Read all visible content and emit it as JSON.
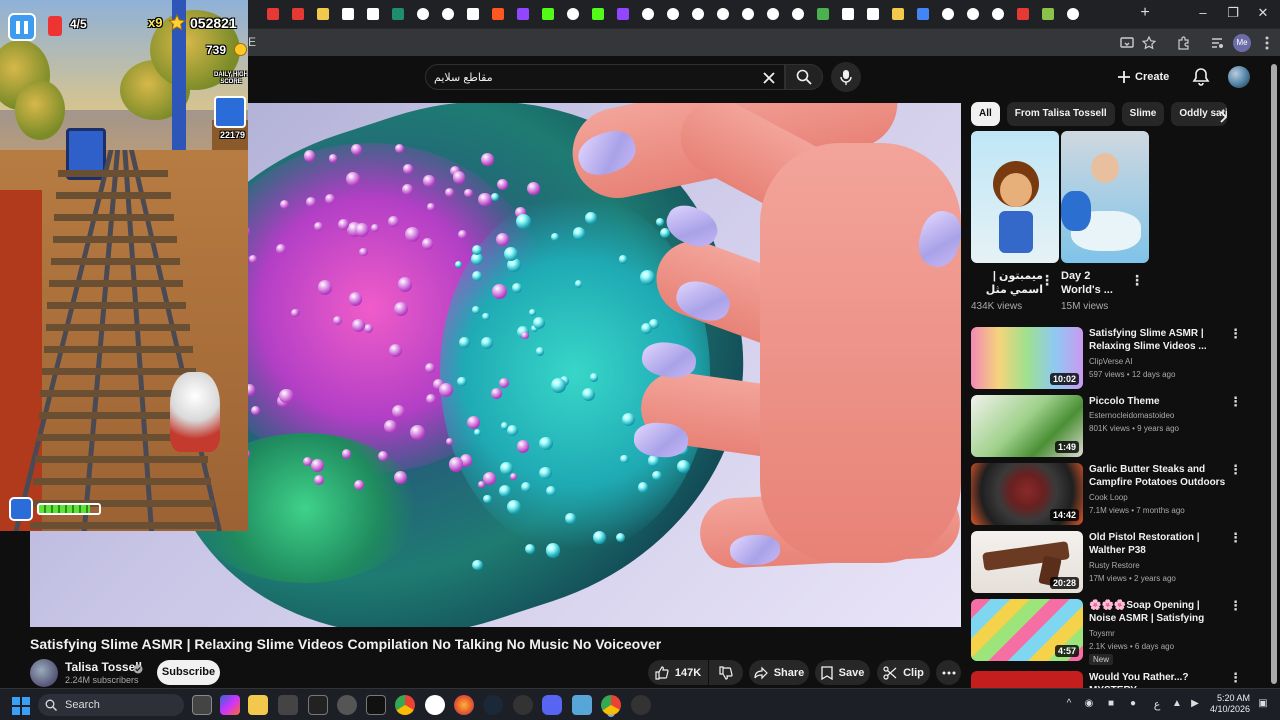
{
  "browser": {
    "new_tab_label": "+",
    "address_text": "E",
    "profile_initials": "Me",
    "tabs": [
      {
        "color": "#e53935",
        "icon": "youtube-icon"
      },
      {
        "color": "#e53935",
        "icon": "youtube-icon"
      },
      {
        "color": "#f2c94c",
        "icon": "generic-site-icon"
      },
      {
        "color": "#ffffff",
        "icon": "generic-site-icon"
      },
      {
        "color": "#ffffff",
        "icon": "wikipedia-icon"
      },
      {
        "color": "#1e8e6e",
        "icon": "generic-site-icon"
      },
      {
        "color": "#ffffff",
        "icon": "google-icon"
      },
      {
        "color": "#ffffff",
        "icon": "google-icon"
      },
      {
        "color": "#ffffff",
        "icon": "compass-icon"
      },
      {
        "color": "#ff5722",
        "icon": "generic-site-icon"
      },
      {
        "color": "#9146ff",
        "icon": "twitch-icon"
      },
      {
        "color": "#53fc18",
        "icon": "kick-icon"
      },
      {
        "color": "#ffffff",
        "icon": "google-icon"
      },
      {
        "color": "#53fc18",
        "icon": "kick-icon"
      },
      {
        "color": "#9146ff",
        "icon": "twitch-icon"
      },
      {
        "color": "#ffffff",
        "icon": "google-icon"
      },
      {
        "color": "#ffffff",
        "icon": "google-icon"
      },
      {
        "color": "#ffffff",
        "icon": "google-icon"
      },
      {
        "color": "#ffffff",
        "icon": "google-icon"
      },
      {
        "color": "#ffffff",
        "icon": "google-icon"
      },
      {
        "color": "#ffffff",
        "icon": "google-icon"
      },
      {
        "color": "#ffffff",
        "icon": "google-icon"
      },
      {
        "color": "#4caf50",
        "icon": "grid-icon"
      },
      {
        "color": "#ffffff",
        "icon": "pen-icon"
      },
      {
        "color": "#ffffff",
        "icon": "pen-icon"
      },
      {
        "color": "#f2c94c",
        "icon": "docs-icon"
      },
      {
        "color": "#4285f4",
        "icon": "generic-site-icon"
      },
      {
        "color": "#ffffff",
        "icon": "google-icon"
      },
      {
        "color": "#ffffff",
        "icon": "google-icon"
      },
      {
        "color": "#ffffff",
        "icon": "google-icon"
      },
      {
        "color": "#e53935",
        "icon": "pdf-icon"
      },
      {
        "color": "#8bc34a",
        "icon": "generic-site-icon"
      },
      {
        "color": "#ffffff",
        "icon": "google-icon"
      }
    ]
  },
  "youtube": {
    "search_query": "مقاطع سلايم",
    "create_label": "Create",
    "video": {
      "title": "Satisfying Slime ASMR | Relaxing Slime Videos Compilation No Talking No Music No Voiceover",
      "channel": "Talisa Tossell",
      "subscribers": "2.24M subscribers",
      "subscribe_label": "Subscribe",
      "likes": "147K",
      "share_label": "Share",
      "save_label": "Save",
      "clip_label": "Clip"
    },
    "chips": [
      "All",
      "From Talisa Tossell",
      "Slime",
      "Oddly satis"
    ],
    "shorts": [
      {
        "title": "ميمبتون | اسمي مثل طفول وضي...",
        "views": "434K views"
      },
      {
        "title": "Day 2 World's ...",
        "views": "15M views"
      }
    ],
    "recommendations": [
      {
        "title": "Satisfying Slime ASMR | Relaxing Slime Videos ...",
        "channel": "ClipVerse AI",
        "meta": "597 views • 12 days ago",
        "duration": "10:02",
        "new": ""
      },
      {
        "title": "Piccolo Theme",
        "channel": "Esternocleidomastoideo",
        "meta": "801K views • 9 years ago",
        "duration": "1:49",
        "new": ""
      },
      {
        "title": "Garlic Butter Steaks and Campfire Potatoes Outdoors",
        "channel": "Cook Loop",
        "meta": "7.1M views • 7 months ago",
        "duration": "14:42",
        "new": ""
      },
      {
        "title": "Old Pistol Restoration | Walther P38",
        "channel": "Rusty Restore",
        "meta": "17M views • 2 years ago",
        "duration": "20:28",
        "new": ""
      },
      {
        "title": "🌸🌸🌸Soap Opening | Noise ASMR | Satisfying Video | ASM...",
        "channel": "Toysmr",
        "meta": "2.1K views • 6 days ago",
        "duration": "4:57",
        "new": "New"
      },
      {
        "title": "Would You Rather...? MYSTERY",
        "channel": "",
        "meta": "",
        "duration": "",
        "new": ""
      }
    ]
  },
  "game": {
    "progress": "4/5",
    "multiplier": "x9",
    "score": "052821",
    "coins": "739",
    "side_label": "DAILY HIGH SCORE",
    "side_score": "22179",
    "power_level": 0.85
  },
  "taskbar": {
    "search_label": "Search",
    "time": "5:20 AM",
    "date": "4/10/2026",
    "lang": "ع"
  }
}
